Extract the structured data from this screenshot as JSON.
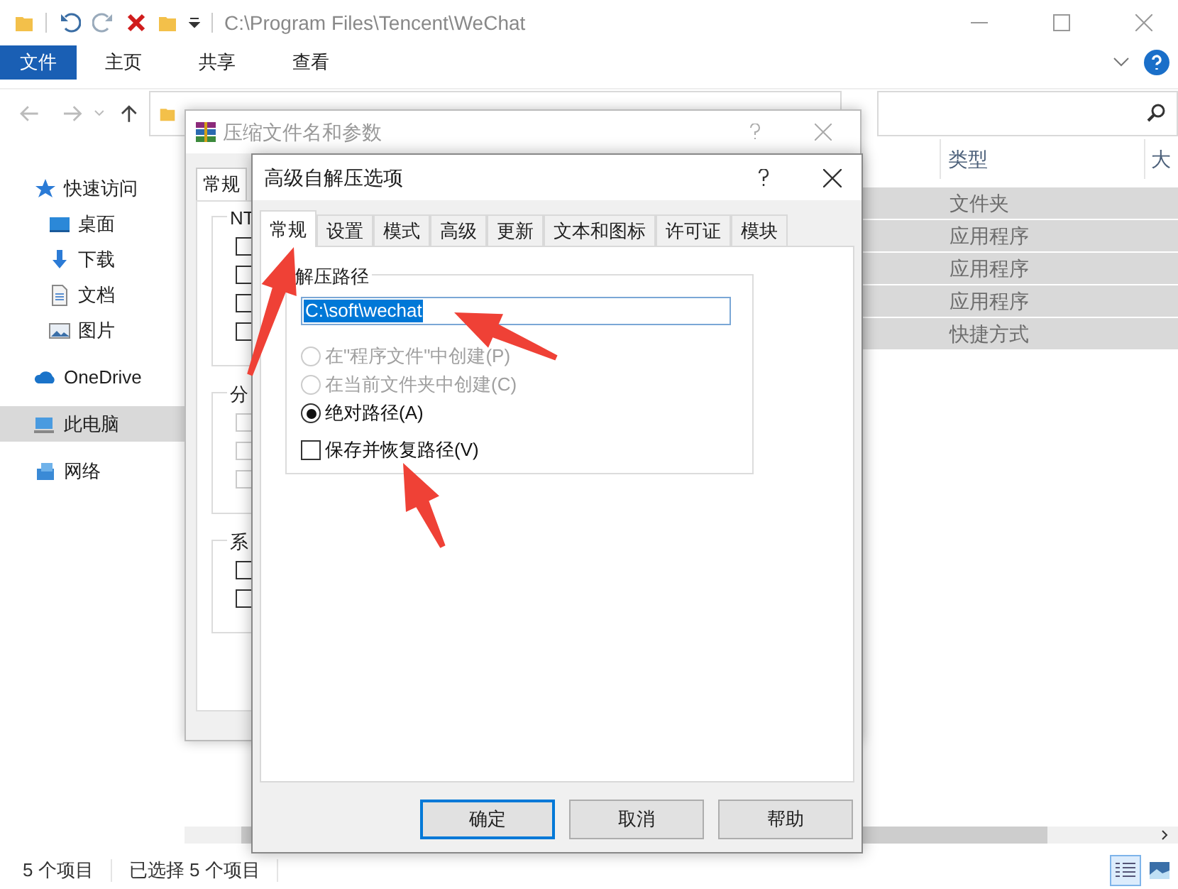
{
  "explorer": {
    "title": "C:\\Program Files\\Tencent\\WeChat",
    "ribbon_tabs": [
      {
        "label": "文件",
        "selected": true
      },
      {
        "label": "主页",
        "selected": false
      },
      {
        "label": "共享",
        "selected": false
      },
      {
        "label": "查看",
        "selected": false
      }
    ],
    "sidebar": {
      "items": [
        {
          "label": "快速访问",
          "selected": false
        },
        {
          "label": "桌面",
          "selected": false
        },
        {
          "label": "下载",
          "selected": false
        },
        {
          "label": "文档",
          "selected": false
        },
        {
          "label": "图片",
          "selected": false
        },
        {
          "label": "OneDrive",
          "selected": false
        },
        {
          "label": "此电脑",
          "selected": true
        },
        {
          "label": "网络",
          "selected": false
        }
      ]
    },
    "table": {
      "columns": [
        "类型",
        "大"
      ],
      "rows": [
        {
          "type": "文件夹",
          "selected": true
        },
        {
          "type": "应用程序",
          "selected": true
        },
        {
          "type": "应用程序",
          "selected": true
        },
        {
          "type": "应用程序",
          "selected": true
        },
        {
          "type": "快捷方式",
          "selected": true
        }
      ]
    },
    "status_bar": {
      "item_count": "5 个项目",
      "selection": "已选择 5 个项目"
    }
  },
  "archive_dialog": {
    "title": "压缩文件名和参数",
    "tabs": [
      {
        "label": "常规",
        "selected": true
      }
    ],
    "groups": [
      {
        "label": "NT",
        "checkboxes": [
          {
            "checked": false,
            "disabled": false
          },
          {
            "checked": false,
            "disabled": false
          },
          {
            "checked": false,
            "disabled": false
          },
          {
            "checked": false,
            "disabled": false
          }
        ]
      },
      {
        "label": "分",
        "checkboxes": [
          {
            "checked": false,
            "disabled": true
          },
          {
            "checked": false,
            "disabled": true
          },
          {
            "checked": false,
            "disabled": true
          }
        ]
      },
      {
        "label": "系",
        "checkboxes": [
          {
            "checked": false,
            "disabled": false
          },
          {
            "checked": false,
            "disabled": false
          }
        ]
      }
    ]
  },
  "options_dialog": {
    "title": "高级自解压选项",
    "tabs": [
      {
        "label": "常规",
        "selected": true
      },
      {
        "label": "设置",
        "selected": false
      },
      {
        "label": "模式",
        "selected": false
      },
      {
        "label": "高级",
        "selected": false
      },
      {
        "label": "更新",
        "selected": false
      },
      {
        "label": "文本和图标",
        "selected": false
      },
      {
        "label": "许可证",
        "selected": false
      },
      {
        "label": "模块",
        "selected": false
      }
    ],
    "path_group": {
      "label": "解压路径",
      "path": "C:\\soft\\wechat",
      "path_selected": true,
      "options": [
        {
          "kind": "radio",
          "label": "在\"程序文件\"中创建(P)",
          "selected": false,
          "disabled": true
        },
        {
          "kind": "radio",
          "label": "在当前文件夹中创建(C)",
          "selected": false,
          "disabled": true
        },
        {
          "kind": "radio",
          "label": "绝对路径(A)",
          "selected": true,
          "disabled": false
        },
        {
          "kind": "checkbox",
          "label": "保存并恢复路径(V)",
          "checked": false,
          "disabled": false
        }
      ]
    },
    "buttons": [
      {
        "label": "确定",
        "default": true
      },
      {
        "label": "取消",
        "default": false
      },
      {
        "label": "帮助",
        "default": false
      }
    ]
  }
}
